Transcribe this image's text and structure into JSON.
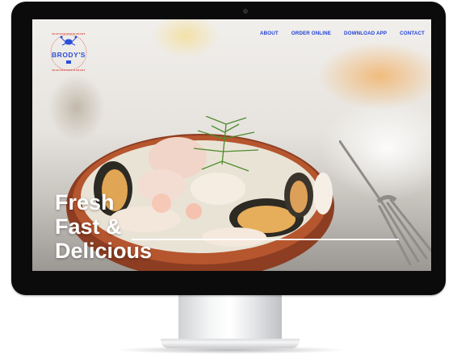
{
  "brand": {
    "name": "BRODY'S",
    "tagline_top": "SEAFOOD RESTAURANT",
    "tagline_bottom": "SEAFOOD RESTAURANT",
    "accent_blue": "#2b4fd8",
    "accent_red": "#d8433c"
  },
  "nav": {
    "items": [
      {
        "label": "ABOUT"
      },
      {
        "label": "ORDER ONLINE"
      },
      {
        "label": "DOWNLOAD APP"
      },
      {
        "label": "CONTACT"
      }
    ],
    "color": "#1e3fd6"
  },
  "hero": {
    "line1": "Fresh",
    "line2": "Fast &",
    "line3": "Delicious"
  }
}
